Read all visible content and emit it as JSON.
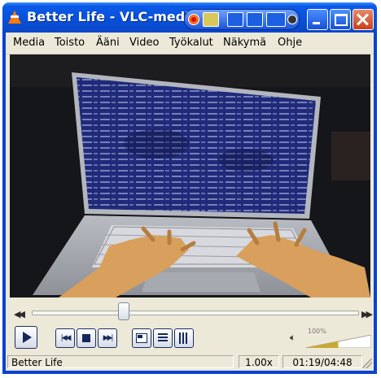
{
  "window": {
    "title": "Better Life - VLC-mediasoitin"
  },
  "menu": [
    "Media",
    "Toisto",
    "Ääni",
    "Video",
    "Työkalut",
    "Näkymä",
    "Ohje"
  ],
  "video": {
    "content": "laptop-typing-hands"
  },
  "seek": {
    "position_fraction": 0.28
  },
  "volume": {
    "label": "100%",
    "level_fraction": 0.5
  },
  "status": {
    "title": "Better Life",
    "speed": "1.00x",
    "time": "01:19/04:48"
  },
  "colors": {
    "titlebar": "#0a48c8",
    "face": "#ece9d8",
    "vlc_orange": "#ff7a00"
  },
  "icons": [
    "vlc-cone-icon",
    "play-icon",
    "previous-icon",
    "stop-icon",
    "next-icon",
    "fullscreen-icon",
    "playlist-icon",
    "extended-settings-icon",
    "speaker-icon"
  ]
}
